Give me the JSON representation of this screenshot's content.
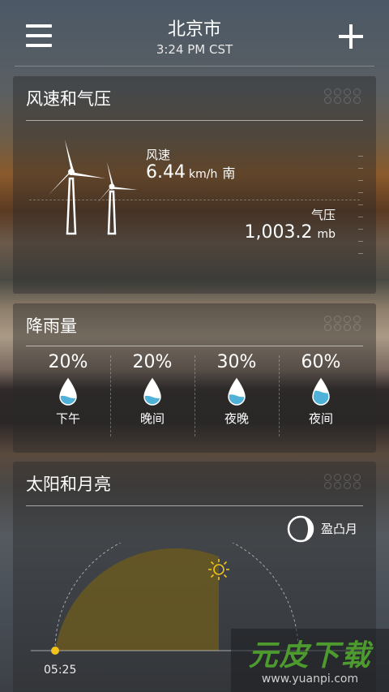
{
  "header": {
    "city": "北京市",
    "time": "3:24 PM CST"
  },
  "wind_card": {
    "title": "风速和气压",
    "wind_label": "风速",
    "wind_value": "6.44",
    "wind_unit": "km/h",
    "wind_dir": "南",
    "pressure_label": "气压",
    "pressure_value": "1,003.2",
    "pressure_unit": "mb"
  },
  "rain_card": {
    "title": "降雨量",
    "items": [
      {
        "percent": "20%",
        "label": "下午",
        "level": 0.2
      },
      {
        "percent": "20%",
        "label": "晚间",
        "level": 0.2
      },
      {
        "percent": "30%",
        "label": "夜晚",
        "level": 0.3
      },
      {
        "percent": "60%",
        "label": "夜间",
        "level": 0.6
      }
    ]
  },
  "sun_card": {
    "title": "太阳和月亮",
    "moon_phase": "盈凸月",
    "sunrise": "05:25"
  },
  "watermark": {
    "name": "元皮下载",
    "url": "www.yuanpi.com"
  },
  "colors": {
    "sun_fill": "#6b5a1e",
    "sun_dot": "#f2c31a",
    "drop_water": "#4fb0d8"
  }
}
